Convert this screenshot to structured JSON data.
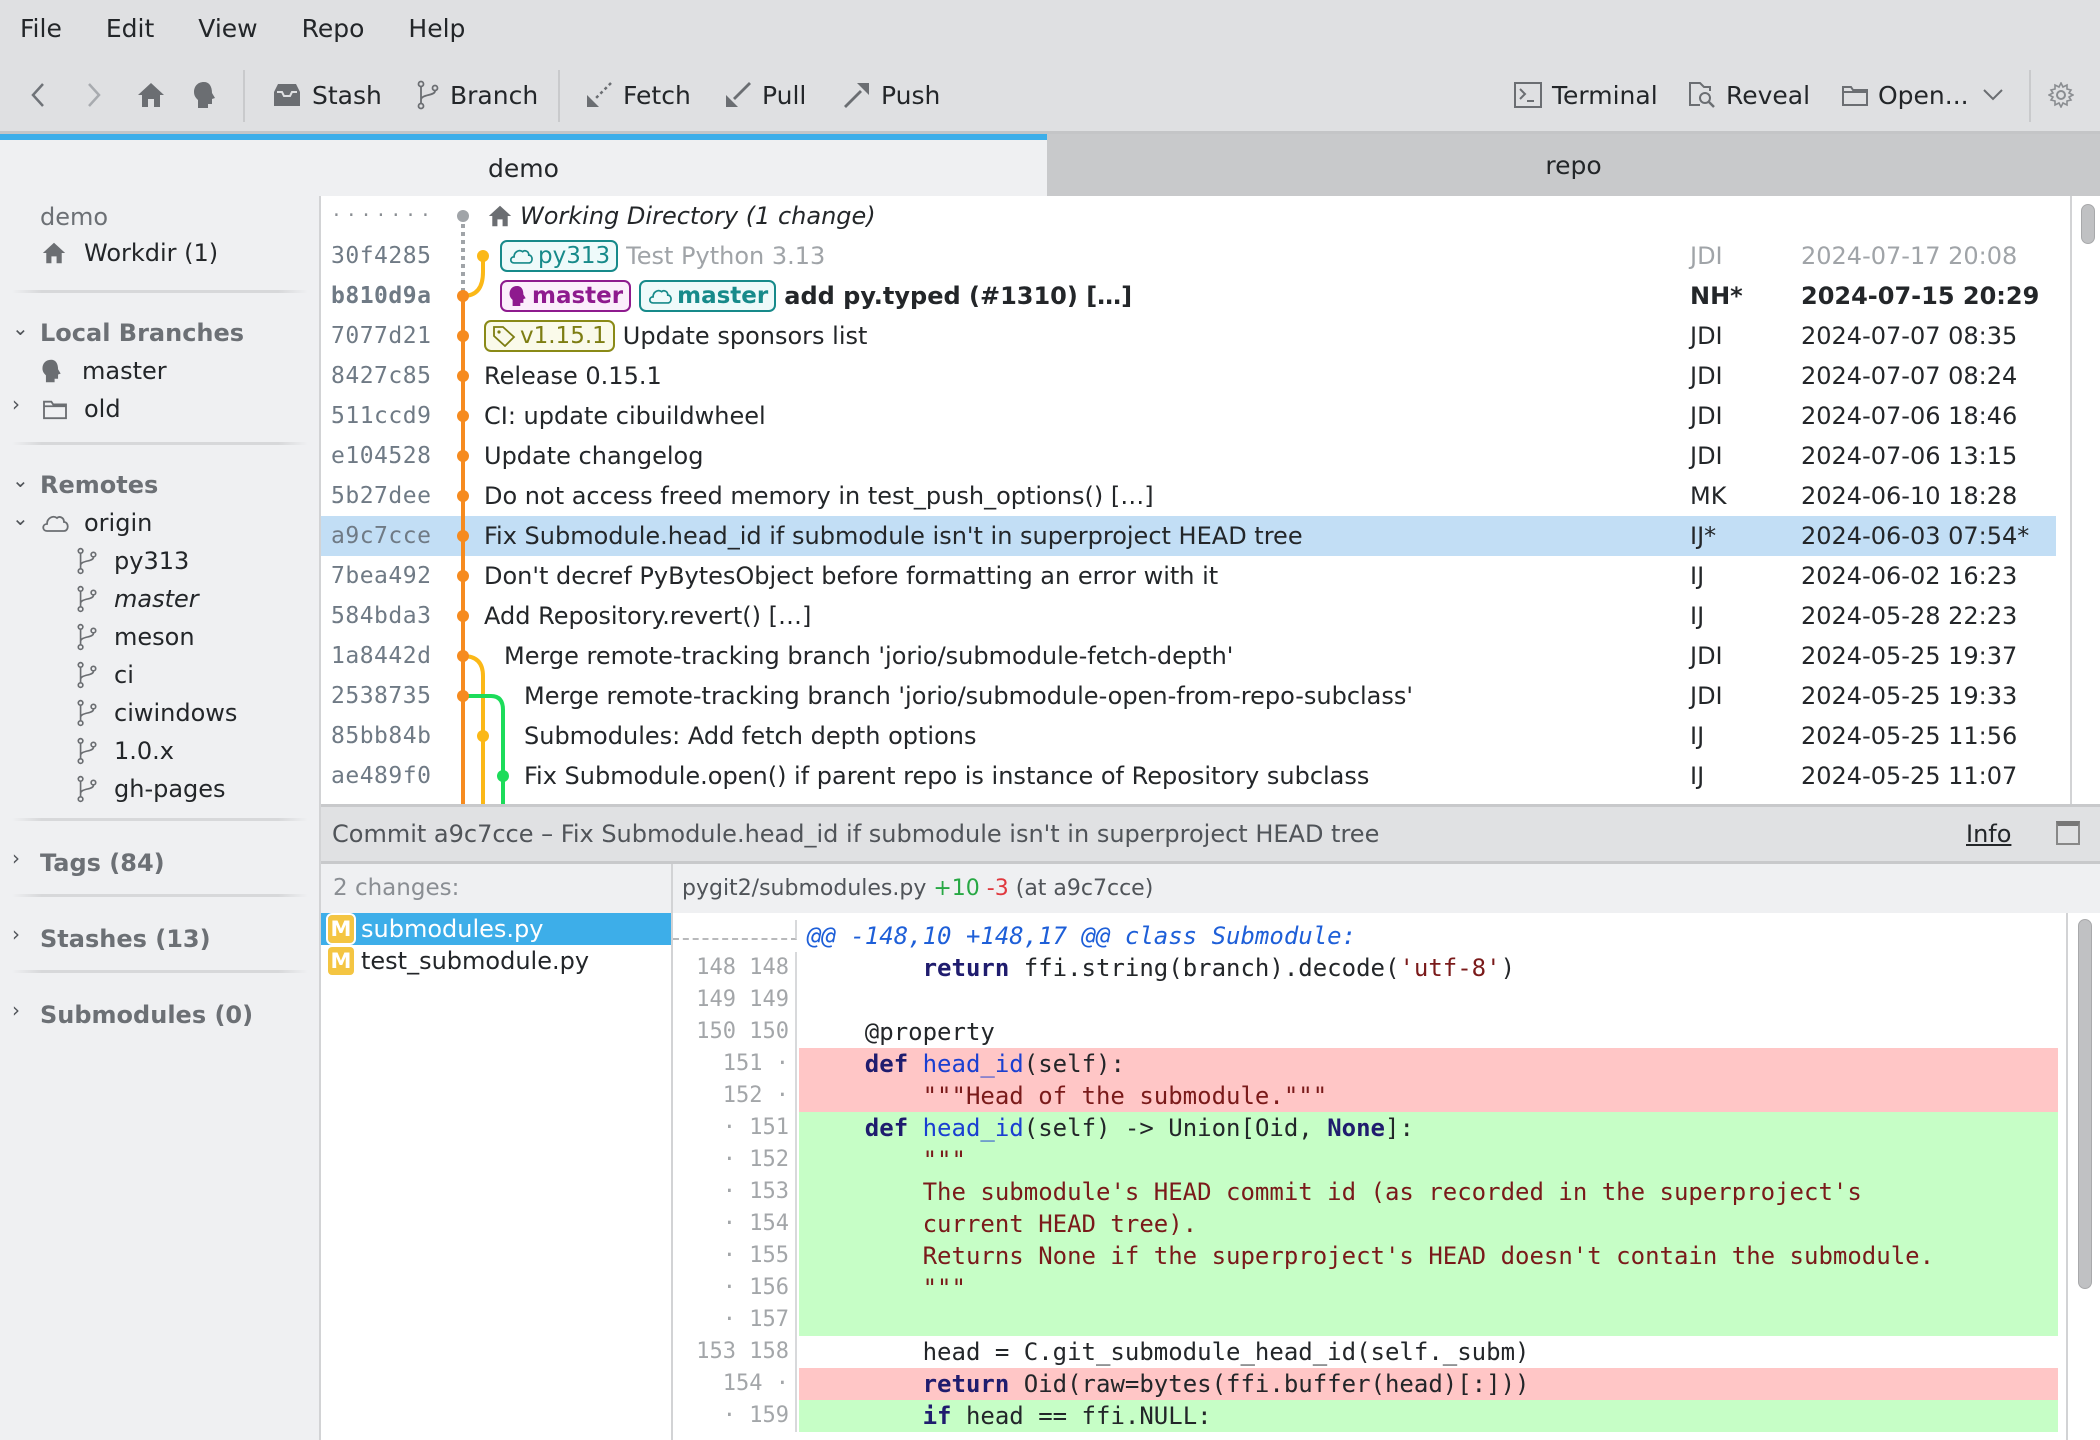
{
  "menu": [
    "File",
    "Edit",
    "View",
    "Repo",
    "Help"
  ],
  "toolbar": {
    "back": "back-arrow-icon",
    "forward": "forward-arrow-icon",
    "home": "home-icon",
    "head": "head-icon",
    "stash": "Stash",
    "branch": "Branch",
    "fetch": "Fetch",
    "pull": "Pull",
    "push": "Push",
    "terminal": "Terminal",
    "reveal": "Reveal",
    "open": "Open...",
    "settings": "gear-icon"
  },
  "tabs": [
    {
      "label": "demo",
      "active": true
    },
    {
      "label": "repo",
      "active": false
    }
  ],
  "sidebar": {
    "repo_name": "demo",
    "workdir": "Workdir (1)",
    "local_branches": {
      "label": "Local Branches",
      "items": [
        "master",
        "old"
      ]
    },
    "remotes": {
      "label": "Remotes",
      "remote": "origin",
      "branches": [
        "py313",
        "master",
        "meson",
        "ci",
        "ciwindows",
        "1.0.x",
        "gh-pages"
      ]
    },
    "tags": "Tags (84)",
    "stashes": "Stashes (13)",
    "submodules": "Submodules (0)"
  },
  "commits": [
    {
      "hash": "·······",
      "message": "Working Directory (1 change)",
      "author": "",
      "date": ""
    },
    {
      "hash": "30f4285",
      "refs": [
        {
          "type": "remote",
          "name": "py313"
        }
      ],
      "message": "Test Python 3.13",
      "author": "JDI",
      "date": "2024-07-17 20:08"
    },
    {
      "hash": "b810d9a",
      "refs": [
        {
          "type": "head",
          "name": "master"
        },
        {
          "type": "remote",
          "name": "master"
        }
      ],
      "message": "add py.typed (#1310) […]",
      "author": "NH*",
      "date": "2024-07-15 20:29"
    },
    {
      "hash": "7077d21",
      "refs": [
        {
          "type": "tag",
          "name": "v1.15.1"
        }
      ],
      "message": "Update sponsors list",
      "author": "JDI",
      "date": "2024-07-07 08:35"
    },
    {
      "hash": "8427c85",
      "message": "Release 0.15.1",
      "author": "JDI",
      "date": "2024-07-07 08:24"
    },
    {
      "hash": "511ccd9",
      "message": "CI: update cibuildwheel",
      "author": "JDI",
      "date": "2024-07-06 18:46"
    },
    {
      "hash": "e104528",
      "message": "Update changelog",
      "author": "JDI",
      "date": "2024-07-06 13:15"
    },
    {
      "hash": "5b27dee",
      "message": "Do not access freed memory in test_push_options() […]",
      "author": "MK",
      "date": "2024-06-10 18:28"
    },
    {
      "hash": "a9c7cce",
      "message": "Fix Submodule.head_id if submodule isn't in superproject HEAD tree",
      "author": "IJ*",
      "date": "2024-06-03 07:54*"
    },
    {
      "hash": "7bea492",
      "message": "Don't decref PyBytesObject before formatting an error with it",
      "author": "IJ",
      "date": "2024-06-02 16:23"
    },
    {
      "hash": "584bda3",
      "message": "Add Repository.revert() […]",
      "author": "IJ",
      "date": "2024-05-28 22:23"
    },
    {
      "hash": "1a8442d",
      "message": "Merge remote-tracking branch 'jorio/submodule-fetch-depth'",
      "author": "JDI",
      "date": "2024-05-25 19:37"
    },
    {
      "hash": "2538735",
      "message": "Merge remote-tracking branch 'jorio/submodule-open-from-repo-subclass'",
      "author": "JDI",
      "date": "2024-05-25 19:33"
    },
    {
      "hash": "85bb84b",
      "message": "Submodules: Add fetch depth options",
      "author": "IJ",
      "date": "2024-05-25 11:56"
    },
    {
      "hash": "ae489f0",
      "message": "Fix Submodule.open() if parent repo is instance of Repository subclass",
      "author": "IJ",
      "date": "2024-05-25 11:07"
    }
  ],
  "selected_commit_index": 8,
  "graph_colors": {
    "main": "#f68b1f",
    "branch1": "#fbb817",
    "branch2": "#1cdc5a",
    "workdir": "#a0a4a8"
  },
  "commit_bar": {
    "title": "Commit a9c7cce – Fix Submodule.head_id if submodule isn't in superproject HEAD tree",
    "info": "Info"
  },
  "files": {
    "header": "2 changes:",
    "items": [
      {
        "status": "M",
        "name": "submodules.py",
        "selected": true
      },
      {
        "status": "M",
        "name": "test_submodule.py",
        "selected": false
      }
    ]
  },
  "diff": {
    "path": "pygit2/submodules.py",
    "added": "+10",
    "removed": "-3",
    "at": "(at a9c7cce)",
    "lines": [
      {
        "type": "hunk",
        "old": "",
        "new": "",
        "text": "@@ -148,10 +148,17 @@ class Submodule:"
      },
      {
        "type": "ctx",
        "old": "148",
        "new": "148",
        "text": "        return ffi.string(branch).decode('utf-8')"
      },
      {
        "type": "ctx",
        "old": "149",
        "new": "149",
        "text": ""
      },
      {
        "type": "ctx",
        "old": "150",
        "new": "150",
        "text": "    @property"
      },
      {
        "type": "del",
        "old": "151",
        "new": "·",
        "text": "    def head_id(self):"
      },
      {
        "type": "del",
        "old": "152",
        "new": "·",
        "text": "        \"\"\"Head of the submodule.\"\"\""
      },
      {
        "type": "add",
        "old": "·",
        "new": "151",
        "text": "    def head_id(self) -> Union[Oid, None]:"
      },
      {
        "type": "add",
        "old": "·",
        "new": "152",
        "text": "        \"\"\""
      },
      {
        "type": "add",
        "old": "·",
        "new": "153",
        "text": "        The submodule's HEAD commit id (as recorded in the superproject's"
      },
      {
        "type": "add",
        "old": "·",
        "new": "154",
        "text": "        current HEAD tree)."
      },
      {
        "type": "add",
        "old": "·",
        "new": "155",
        "text": "        Returns None if the superproject's HEAD doesn't contain the submodule."
      },
      {
        "type": "add",
        "old": "·",
        "new": "156",
        "text": "        \"\"\""
      },
      {
        "type": "add",
        "old": "·",
        "new": "157",
        "text": ""
      },
      {
        "type": "ctx",
        "old": "153",
        "new": "158",
        "text": "        head = C.git_submodule_head_id(self._subm)"
      },
      {
        "type": "del",
        "old": "154",
        "new": "·",
        "text": "        return Oid(raw=bytes(ffi.buffer(head)[:]))"
      },
      {
        "type": "add",
        "old": "·",
        "new": "159",
        "text": "        if head == ffi.NULL:"
      }
    ]
  }
}
